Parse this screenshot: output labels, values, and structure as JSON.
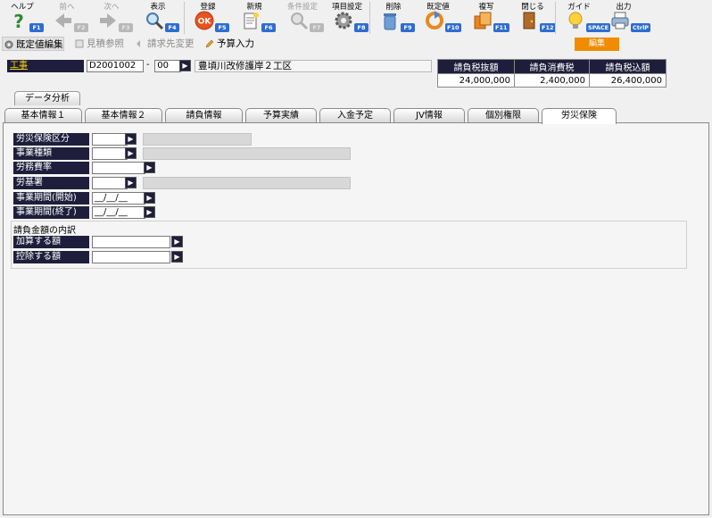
{
  "toolbar": {
    "help": {
      "label": "ヘルプ",
      "key": "F1"
    },
    "prev": {
      "label": "前へ",
      "key": "F2"
    },
    "next": {
      "label": "次へ",
      "key": "F3"
    },
    "view": {
      "label": "表示",
      "key": "F4"
    },
    "register": {
      "label": "登録",
      "key": "F5"
    },
    "new": {
      "label": "新規",
      "key": "F6"
    },
    "condition": {
      "label": "条件設定",
      "key": "F7"
    },
    "item_settings": {
      "label": "項目設定",
      "key": "F8"
    },
    "delete": {
      "label": "削除",
      "key": "F9"
    },
    "default_value": {
      "label": "既定値",
      "key": "F10"
    },
    "copy": {
      "label": "複写",
      "key": "F11"
    },
    "close": {
      "label": "閉じる",
      "key": "F12"
    },
    "guide": {
      "label": "ガイド",
      "key": "SPACE"
    },
    "output": {
      "label": "出力",
      "key": "CtrlP"
    }
  },
  "sub_toolbar": {
    "default_edit": "既定値編集",
    "estimate_ref": "見積参照",
    "billing_change": "請求先変更",
    "budget_input": "予算入力",
    "mode_badge": "編集"
  },
  "project": {
    "label": "工事",
    "code": "D2001002",
    "separator": "-",
    "sub_code": "00",
    "name": "豊頃川改修護岸２工区"
  },
  "amounts": {
    "headers": [
      "請負税抜額",
      "請負消費税",
      "請負税込額"
    ],
    "values": [
      "24,000,000",
      "2,400,000",
      "26,400,000"
    ]
  },
  "data_analysis_tab": "データ分析",
  "tabs": [
    "基本情報１",
    "基本情報２",
    "請負情報",
    "予算実績",
    "入金予定",
    "JV情報",
    "個別権限",
    "労災保険"
  ],
  "active_tab": "労災保険",
  "form": {
    "insurance_class": {
      "label": "労災保険区分",
      "value": ""
    },
    "business_type": {
      "label": "事業種類",
      "value": ""
    },
    "labor_rate": {
      "label": "労務費率",
      "value": ""
    },
    "labor_office": {
      "label": "労基署",
      "value": ""
    },
    "period_start": {
      "label": "事業期間(開始)",
      "value": "__/__/__"
    },
    "period_end": {
      "label": "事業期間(終了)",
      "value": "__/__/__"
    },
    "breakdown_title": "請負金額の内訳",
    "add_amount": {
      "label": "加算する額",
      "value": ""
    },
    "deduct_amount": {
      "label": "控除する額",
      "value": ""
    }
  },
  "colors": {
    "label_bg": "#1e1e3c",
    "accent_orange": "#f08c00",
    "key_blue": "#2f6ccf"
  }
}
